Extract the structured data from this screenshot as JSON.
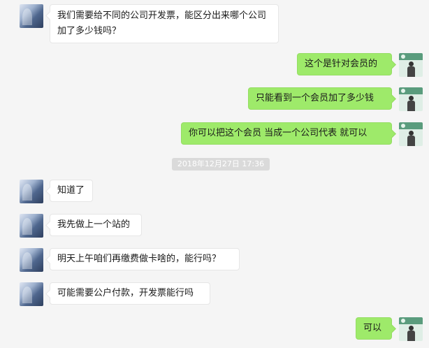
{
  "chat": {
    "timestamp": "2018年12月27日 17:36",
    "messages": [
      {
        "side": "left",
        "text": "我们需要给不同的公司开发票，能区分出来哪个公司加了多少钱吗？"
      },
      {
        "side": "right",
        "text": "这个是针对会员的"
      },
      {
        "side": "right",
        "text": "只能看到一个会员加了多少钱"
      },
      {
        "side": "right",
        "text": "你可以把这个会员 当成一个公司代表  就可以"
      },
      {
        "side": "left",
        "text": "知道了"
      },
      {
        "side": "left",
        "text": "我先做上一个站的"
      },
      {
        "side": "left",
        "text": "明天上午咱们再缴费做卡啥的，能行吗？"
      },
      {
        "side": "left",
        "text": "可能需要公户付款，开发票能行吗"
      },
      {
        "side": "right",
        "text": "可以"
      }
    ]
  }
}
